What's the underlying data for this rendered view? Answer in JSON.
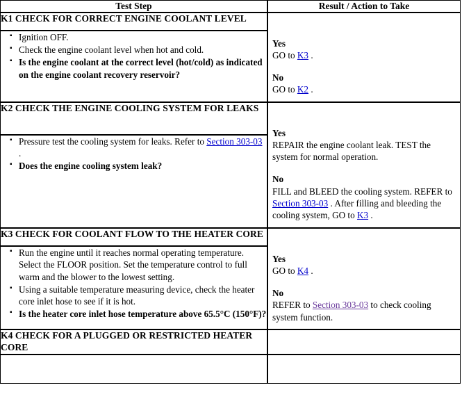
{
  "table": {
    "headers": {
      "test_step": "Test Step",
      "result_action": "Result / Action to Take"
    },
    "steps": [
      {
        "id": "K1",
        "title": "K1 CHECK FOR CORRECT ENGINE COOLANT LEVEL",
        "bullets": [
          {
            "text": "Ignition OFF.",
            "bold": false
          },
          {
            "text": "Check the engine coolant level when hot and cold.",
            "bold": false
          },
          {
            "text": "Is the engine coolant at the correct level (hot/cold) as indicated on the engine coolant recovery reservoir?",
            "bold": true
          }
        ],
        "results": {
          "yes_label": "Yes",
          "yes_pre": "GO to ",
          "yes_link": "K3",
          "yes_post": " .",
          "no_label": "No",
          "no_pre": "GO to ",
          "no_link": "K2",
          "no_post": " ."
        }
      },
      {
        "id": "K2",
        "title": "K2 CHECK THE ENGINE COOLING SYSTEM FOR LEAKS",
        "bullets": [
          {
            "text": "Pressure test the cooling system for leaks. Refer to ",
            "link": "Section 303-03",
            "after": " .",
            "bold": false
          },
          {
            "text": "Does the engine cooling system leak?",
            "bold": true
          }
        ],
        "results": {
          "yes_label": "Yes",
          "yes_text": "REPAIR the engine coolant leak. TEST the system for normal operation.",
          "no_label": "No",
          "no_pre": "FILL and BLEED the cooling system. REFER to ",
          "no_link1": "Section 303-03",
          "no_mid": " . After filling and bleeding the cooling system, GO to ",
          "no_link2": "K3",
          "no_post": " ."
        }
      },
      {
        "id": "K3",
        "title": "K3 CHECK FOR COOLANT FLOW TO THE HEATER CORE",
        "bullets": [
          {
            "text": "Run the engine until it reaches normal operating temperature. Select the FLOOR position. Set the temperature control to full warm and the blower to the lowest setting.",
            "bold": false
          },
          {
            "text": "Using a suitable temperature measuring device, check the heater core inlet hose to see if it is hot.",
            "bold": false
          },
          {
            "text": "Is the heater core inlet hose temperature above 65.5°C (150°F)?",
            "bold": true
          }
        ],
        "results": {
          "yes_label": "Yes",
          "yes_pre": "GO to ",
          "yes_link": "K4",
          "yes_post": " .",
          "no_label": "No",
          "no_pre": "REFER to ",
          "no_link1": "Section 303-03",
          "no_post": " to check cooling system function."
        }
      },
      {
        "id": "K4",
        "title": "K4 CHECK FOR A PLUGGED OR RESTRICTED HEATER CORE"
      }
    ]
  }
}
